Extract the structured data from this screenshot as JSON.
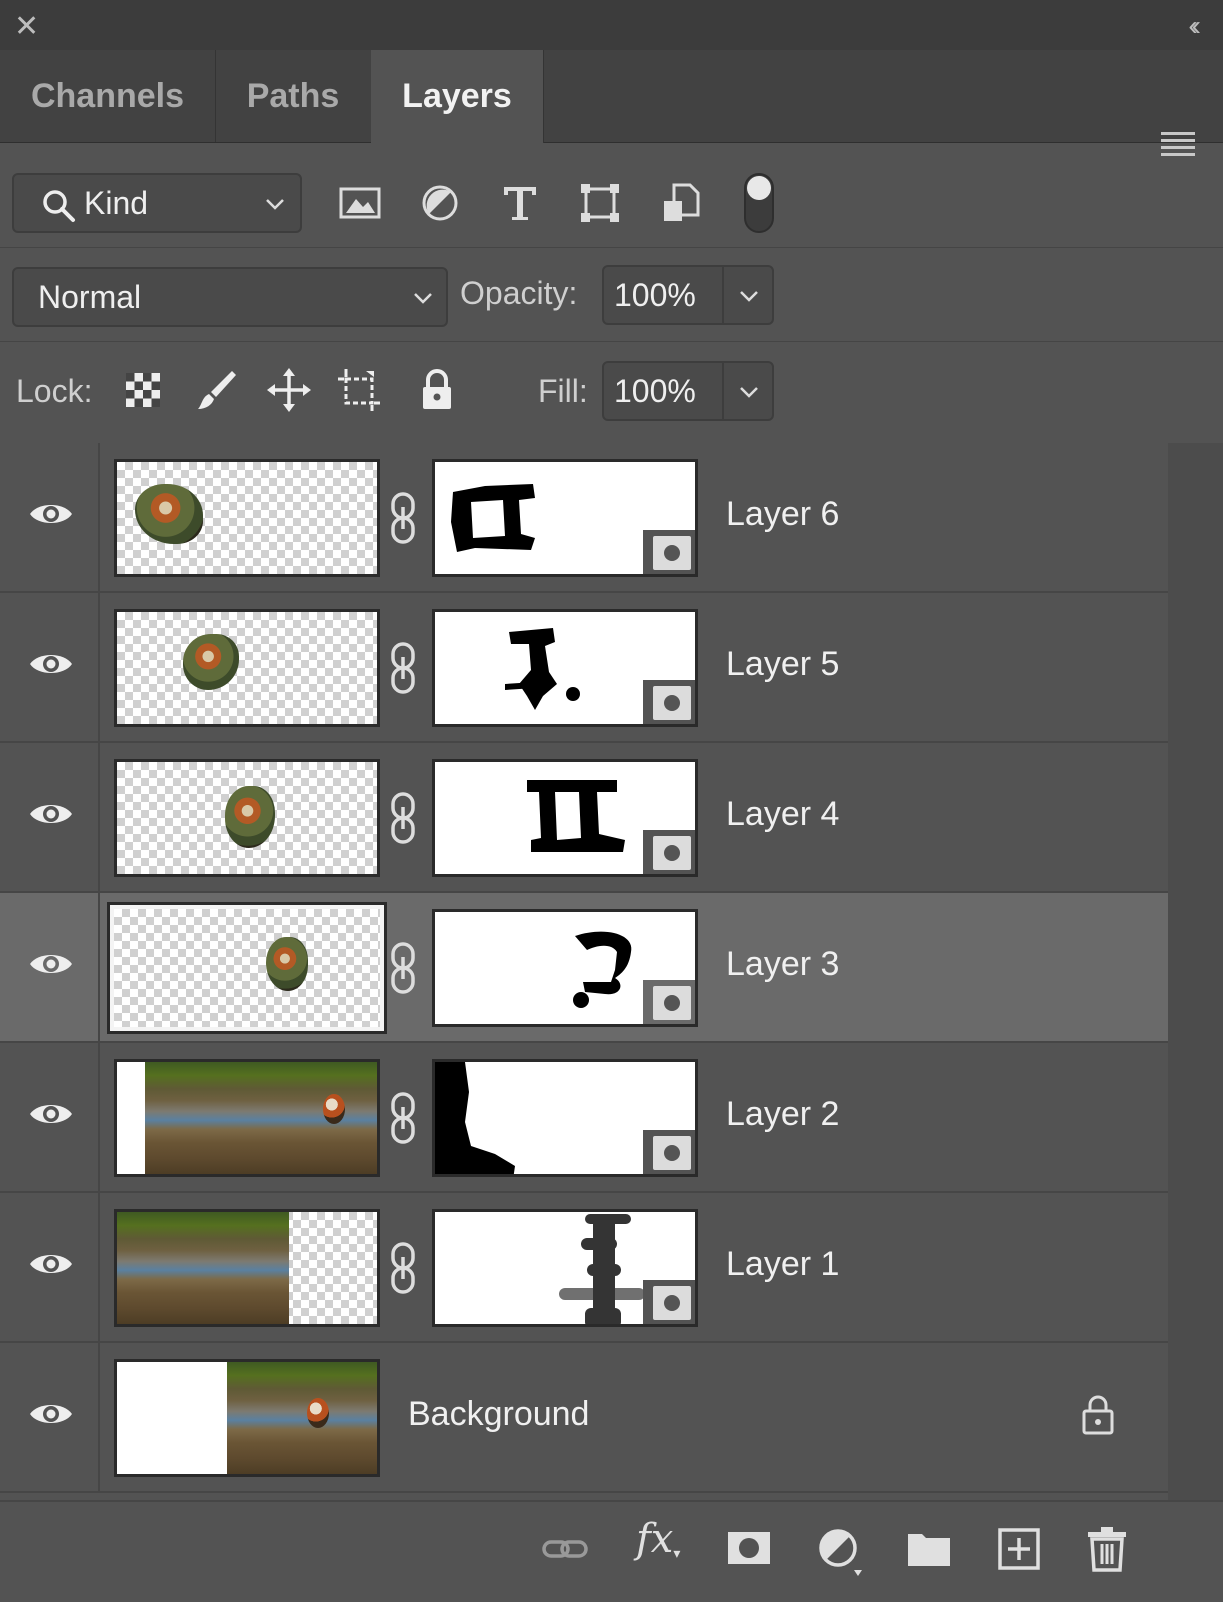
{
  "window": {
    "close_glyph": "✕",
    "collapse_glyph": "‹‹"
  },
  "tabs": [
    {
      "label": "Channels",
      "active": false
    },
    {
      "label": "Paths",
      "active": false
    },
    {
      "label": "Layers",
      "active": true
    }
  ],
  "filter": {
    "kind_label": "Kind",
    "icons": [
      "pixel-layer-filter-icon",
      "adjustment-layer-filter-icon",
      "type-layer-filter-icon",
      "shape-layer-filter-icon",
      "smart-object-filter-icon",
      "filter-toggle-icon"
    ]
  },
  "blending": {
    "mode": "Normal",
    "opacity_label": "Opacity:",
    "opacity_value": "100%"
  },
  "lock": {
    "label": "Lock:",
    "icons": [
      "lock-transparent-pixels-icon",
      "lock-image-pixels-icon",
      "lock-position-icon",
      "lock-artboard-icon",
      "lock-all-icon"
    ],
    "fill_label": "Fill:",
    "fill_value": "100%"
  },
  "layers": [
    {
      "name": "Layer 6",
      "visible": true,
      "selected": false,
      "has_mask": true
    },
    {
      "name": "Layer 5",
      "visible": true,
      "selected": false,
      "has_mask": true
    },
    {
      "name": "Layer 4",
      "visible": true,
      "selected": false,
      "has_mask": true
    },
    {
      "name": "Layer 3",
      "visible": true,
      "selected": true,
      "has_mask": true
    },
    {
      "name": "Layer 2",
      "visible": true,
      "selected": false,
      "has_mask": true
    },
    {
      "name": "Layer 1",
      "visible": true,
      "selected": false,
      "has_mask": true
    },
    {
      "name": "Background",
      "visible": true,
      "selected": false,
      "has_mask": false,
      "locked": true
    }
  ],
  "bottom_bar": {
    "icons": [
      "link-layers-icon",
      "layer-style-fx-icon",
      "add-mask-icon",
      "adjustment-layer-icon",
      "new-group-icon",
      "new-layer-icon",
      "delete-layer-icon"
    ],
    "fx_label": "fx"
  },
  "colors": {
    "panel_bg": "#535353",
    "selected_row": "#6a6a6a",
    "text": "#f0f0f0"
  }
}
